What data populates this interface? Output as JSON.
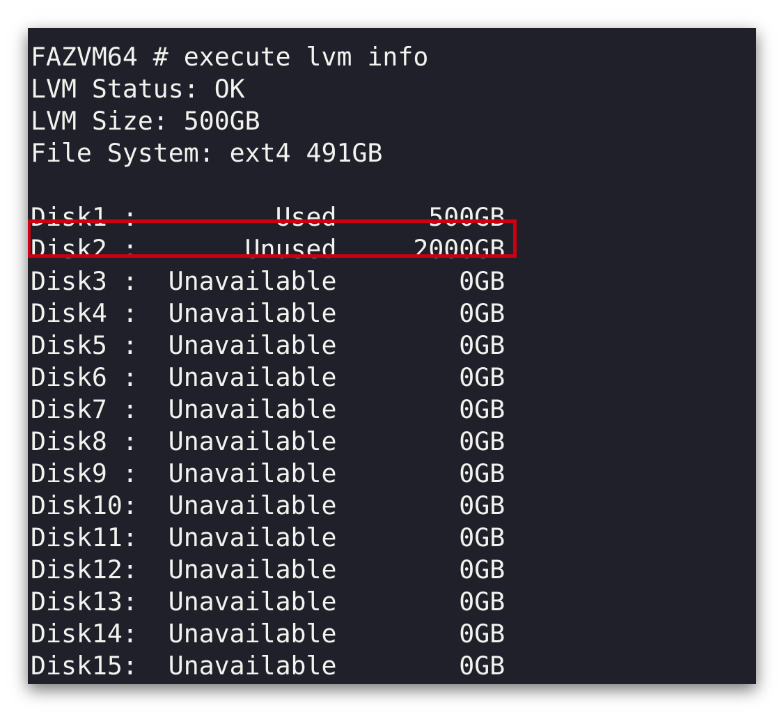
{
  "terminal": {
    "header_lines": [
      "FAZVM64 # execute lvm info",
      "LVM Status: OK",
      "LVM Size: 500GB",
      "File System: ext4 491GB"
    ],
    "disks": [
      {
        "name": "Disk1 :",
        "status": "Used",
        "size": "500GB"
      },
      {
        "name": "Disk2 :",
        "status": "Unused",
        "size": "2000GB"
      },
      {
        "name": "Disk3 :",
        "status": "Unavailable",
        "size": "0GB"
      },
      {
        "name": "Disk4 :",
        "status": "Unavailable",
        "size": "0GB"
      },
      {
        "name": "Disk5 :",
        "status": "Unavailable",
        "size": "0GB"
      },
      {
        "name": "Disk6 :",
        "status": "Unavailable",
        "size": "0GB"
      },
      {
        "name": "Disk7 :",
        "status": "Unavailable",
        "size": "0GB"
      },
      {
        "name": "Disk8 :",
        "status": "Unavailable",
        "size": "0GB"
      },
      {
        "name": "Disk9 :",
        "status": "Unavailable",
        "size": "0GB"
      },
      {
        "name": "Disk10:",
        "status": "Unavailable",
        "size": "0GB"
      },
      {
        "name": "Disk11:",
        "status": "Unavailable",
        "size": "0GB"
      },
      {
        "name": "Disk12:",
        "status": "Unavailable",
        "size": "0GB"
      },
      {
        "name": "Disk13:",
        "status": "Unavailable",
        "size": "0GB"
      },
      {
        "name": "Disk14:",
        "status": "Unavailable",
        "size": "0GB"
      },
      {
        "name": "Disk15:",
        "status": "Unavailable",
        "size": "0GB"
      }
    ],
    "highlight_color": "#cc0010"
  }
}
